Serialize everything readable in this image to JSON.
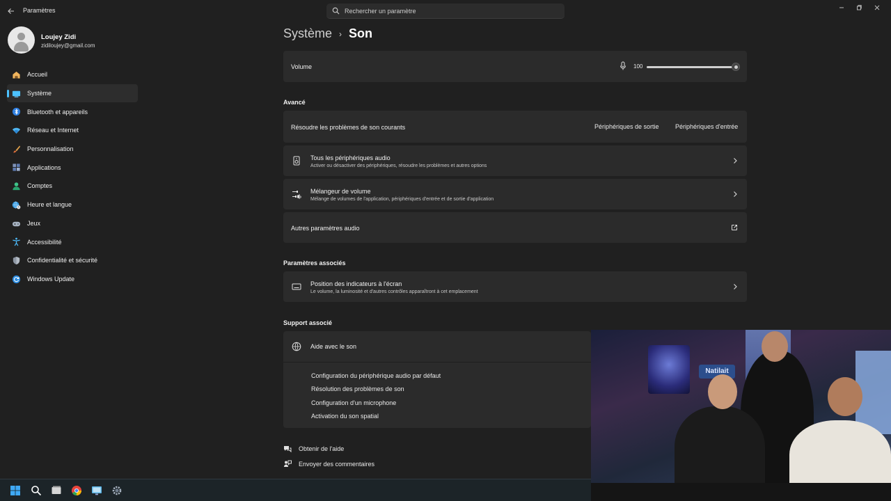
{
  "window": {
    "title": "Paramètres"
  },
  "search": {
    "placeholder": "Rechercher un paramètre"
  },
  "profile": {
    "name": "Loujey Zidi",
    "email": "zidiloujey@gmail.com"
  },
  "sidebar": {
    "items": [
      {
        "label": "Accueil",
        "icon": "home-icon"
      },
      {
        "label": "Système",
        "icon": "system-icon",
        "active": true
      },
      {
        "label": "Bluetooth et appareils",
        "icon": "bluetooth-icon"
      },
      {
        "label": "Réseau et Internet",
        "icon": "wifi-icon"
      },
      {
        "label": "Personnalisation",
        "icon": "brush-icon"
      },
      {
        "label": "Applications",
        "icon": "apps-icon"
      },
      {
        "label": "Comptes",
        "icon": "person-icon"
      },
      {
        "label": "Heure et langue",
        "icon": "globe-clock-icon"
      },
      {
        "label": "Jeux",
        "icon": "gamepad-icon"
      },
      {
        "label": "Accessibilité",
        "icon": "accessibility-icon"
      },
      {
        "label": "Confidentialité et sécurité",
        "icon": "shield-icon"
      },
      {
        "label": "Windows Update",
        "icon": "update-icon"
      }
    ]
  },
  "breadcrumb": {
    "parent": "Système",
    "separator": "›",
    "current": "Son"
  },
  "volume": {
    "label": "Volume",
    "value": "100",
    "level": 1.0
  },
  "advanced": {
    "heading": "Avancé",
    "troubleshoot": {
      "label": "Résoudre les problèmes de son courants",
      "output_link": "Périphériques de sortie",
      "input_link": "Périphériques d'entrée"
    },
    "all_devices": {
      "title": "Tous les périphériques audio",
      "subtitle": "Activer ou désactiver des périphériques, résoudre les problèmes et autres options"
    },
    "mixer": {
      "title": "Mélangeur de volume",
      "subtitle": "Mélange de volumes de l'application, périphériques d'entrée et de sortie d'application"
    },
    "more": {
      "label": "Autres paramètres audio"
    }
  },
  "related": {
    "heading": "Paramètres associés",
    "indicator": {
      "title": "Position des indicateurs à l'écran",
      "subtitle": "Le volume, la luminosité et d'autres contrôles apparaîtront à cet emplacement"
    }
  },
  "support": {
    "heading": "Support associé",
    "help_title": "Aide avec le son",
    "links": [
      "Configuration du périphérique audio par défaut",
      "Résolution des problèmes de son",
      "Configuration d'un microphone",
      "Activation du son spatial"
    ]
  },
  "footer": {
    "get_help": "Obtenir de l'aide",
    "feedback": "Envoyer des commentaires"
  },
  "video": {
    "sign_text": "Natilait"
  },
  "colors": {
    "accent": "#4cc2ff",
    "background": "#202020",
    "card": "#2b2b2b"
  }
}
